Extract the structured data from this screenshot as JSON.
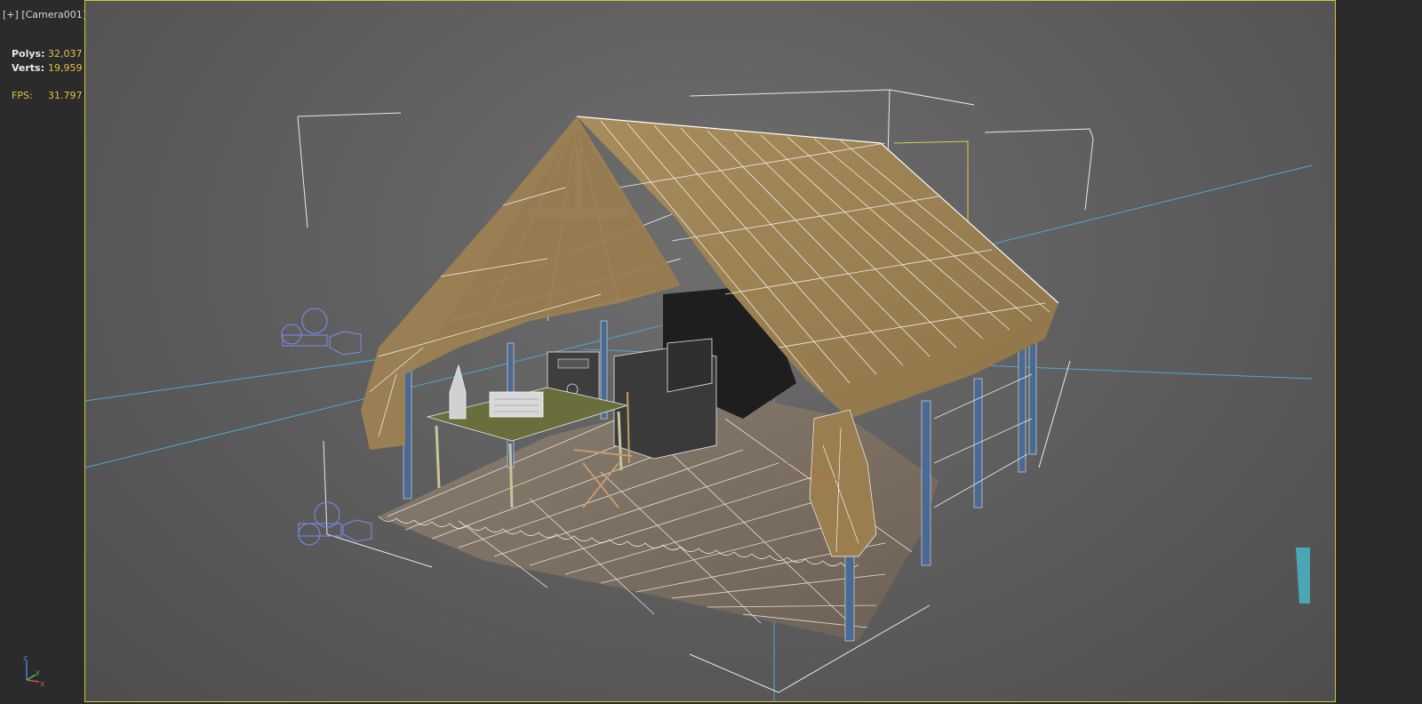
{
  "viewport": {
    "menu_label": "[+]",
    "camera_label": "[Camera001]"
  },
  "stats": {
    "polys_label": "Polys:",
    "polys_value": "32,037",
    "verts_label": "Verts:",
    "verts_value": "19,959",
    "fps_label": "FPS:",
    "fps_value": "31.797"
  },
  "gizmo": {
    "z_label": "z",
    "x_label": "x",
    "y_label": "y"
  },
  "colors": {
    "viewport_border": "#d4c83a",
    "stat_value": "#e3c04a",
    "helper_line": "#4aa8d8",
    "camera_wire": "#7d8cf0",
    "canvas_fabric": "#a58a58",
    "frame_blue": "#4a6a94",
    "table_green": "#6a6d3c"
  },
  "icons": {
    "camera": "camera-icon",
    "axis": "axis-tripod-icon"
  }
}
